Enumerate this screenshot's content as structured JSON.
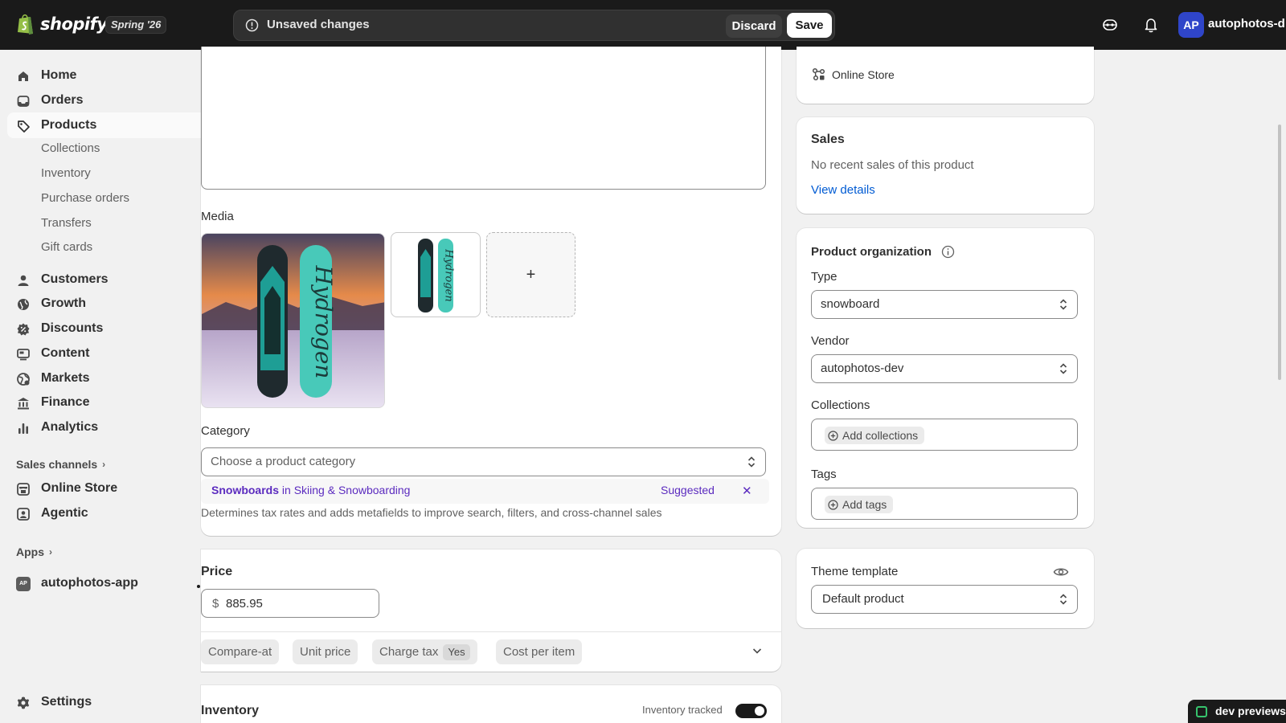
{
  "topbar": {
    "brand": "shopify",
    "version": "Spring '26",
    "unsaved_text": "Unsaved changes",
    "discard_label": "Discard",
    "save_label": "Save",
    "avatar_initials": "AP",
    "account_name": "autophotos-d"
  },
  "sidebar": {
    "items": [
      {
        "label": "Home",
        "icon": "home-icon"
      },
      {
        "label": "Orders",
        "icon": "inbox-icon"
      },
      {
        "label": "Products",
        "icon": "tag-icon"
      }
    ],
    "product_subitems": [
      "Collections",
      "Inventory",
      "Purchase orders",
      "Transfers",
      "Gift cards"
    ],
    "items2": [
      {
        "label": "Customers",
        "icon": "person-icon"
      },
      {
        "label": "Growth",
        "icon": "globe-icon"
      },
      {
        "label": "Discounts",
        "icon": "discount-icon"
      },
      {
        "label": "Content",
        "icon": "content-icon"
      },
      {
        "label": "Markets",
        "icon": "markets-icon"
      },
      {
        "label": "Finance",
        "icon": "bank-icon"
      },
      {
        "label": "Analytics",
        "icon": "chart-icon"
      }
    ],
    "sales_channels_label": "Sales channels",
    "channels": [
      {
        "label": "Online Store",
        "icon": "store-icon"
      },
      {
        "label": "Agentic",
        "icon": "agentic-icon"
      }
    ],
    "apps_label": "Apps",
    "apps": [
      {
        "label": "autophotos-app",
        "icon_text": "AP"
      }
    ],
    "settings_label": "Settings"
  },
  "main": {
    "media_label": "Media",
    "add_media": "+",
    "category_label": "Category",
    "category_placeholder": "Choose a product category",
    "suggestion": {
      "name": "Snowboards",
      "mid": " in ",
      "path": "Skiing & Snowboarding",
      "tag": "Suggested",
      "dismiss": "✕"
    },
    "category_help": "Determines tax rates and adds metafields to improve search, filters, and cross-channel sales",
    "price_label": "Price",
    "currency": "$",
    "price_value": "885.95",
    "chips": {
      "compare_at": "Compare-at",
      "unit_price": "Unit price",
      "charge_tax": "Charge tax",
      "charge_tax_value": "Yes",
      "cost_per_item": "Cost per item"
    },
    "inventory_label": "Inventory",
    "inventory_tracked_label": "Inventory tracked",
    "inventory_tracked_on": true
  },
  "right": {
    "publishing_channel": "Online Store",
    "sales_title": "Sales",
    "sales_text": "No recent sales of this product",
    "sales_link": "View details",
    "org_title": "Product organization",
    "type_label": "Type",
    "type_value": "snowboard",
    "vendor_label": "Vendor",
    "vendor_value": "autophotos-dev",
    "collections_label": "Collections",
    "add_collections": "Add collections",
    "tags_label": "Tags",
    "add_tags": "Add tags",
    "theme_title": "Theme template",
    "theme_value": "Default product"
  },
  "dev_badge": "dev previews",
  "colors": {
    "topbar": "#1a1a1a",
    "link": "#005bd3",
    "suggestion": "#5b2bbf",
    "avatar": "#2f45c9"
  }
}
